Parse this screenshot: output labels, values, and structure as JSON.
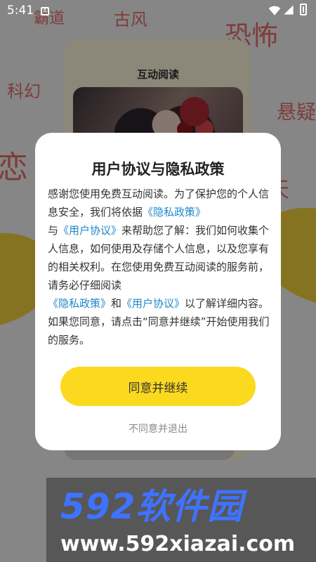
{
  "status_bar": {
    "time": "5:41",
    "notification_letter": "A"
  },
  "background": {
    "floating_words": [
      "霸道",
      "古风",
      "恐怖",
      "科幻",
      "悬疑",
      "恋",
      "天"
    ],
    "preview_title": "互动阅读"
  },
  "dialog": {
    "title": "用户协议与隐私政策",
    "text_1": "感谢您使用免费互动阅读。为了保护您的个人信息安全，我们将依据",
    "privacy_link_1": "《隐私政策》",
    "text_2": "与",
    "user_agreement_link_1": "《用户协议》",
    "text_3": "来帮助您了解：我们如何收集个人信息，如何使用及存储个人信息，以及您享有的相关权利。在您使用免费互动阅读的服务前，请务必仔细阅读",
    "privacy_link_2": "《隐私政策》",
    "text_4": "和",
    "user_agreement_link_2": "《用户协议》",
    "text_5": "以了解详细内容。如果您同意，请点击“同意并继续”开始使用我们的服务。",
    "agree_label": "同意并继续",
    "decline_label": "不同意并退出"
  },
  "watermark": {
    "logo": "592软件园",
    "url": "www.592xiazai.com"
  },
  "colors": {
    "accent": "#fbd91e",
    "link": "#2087c9",
    "floating_text": "#e35a55"
  },
  "icons": [
    "wifi-icon",
    "signal-icon",
    "battery-icon"
  ]
}
